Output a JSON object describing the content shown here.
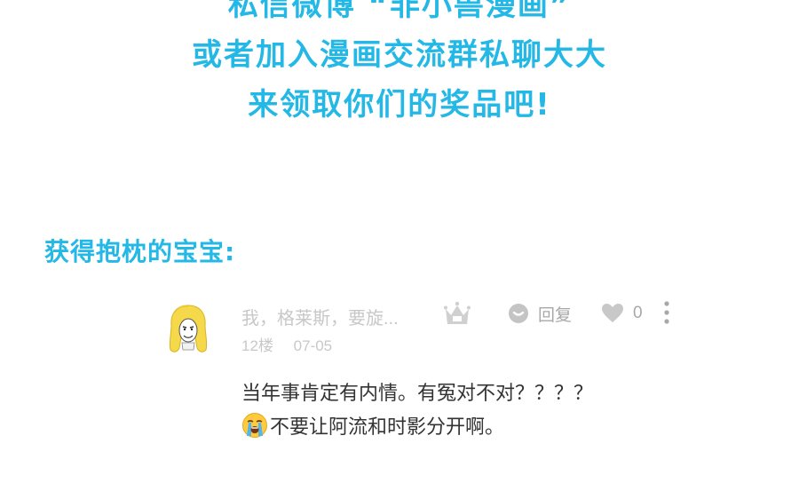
{
  "colors": {
    "accent": "#23b8e6",
    "muted": "#c8c8c8",
    "action": "#a8a8a8",
    "body_text": "#333333"
  },
  "announcement": {
    "line_1": "私信微博 “非小兽漫画”",
    "line_2": "或者加入漫画交流群私聊大大",
    "line_3": "来领取你们的奖品吧!"
  },
  "section_heading": "获得抱枕的宝宝:",
  "comment": {
    "username": "我，格莱斯，要旋...",
    "badge_icon": "crown-icon",
    "reply_label": "回复",
    "reply_icon": "speech-bubble-icon",
    "like_icon": "heart-icon",
    "like_count": "0",
    "more_icon": "more-vertical-icon",
    "floor": "12楼",
    "date": "07-05",
    "body_line_1": "当年事肯定有内情。有冤对不对？？？？",
    "body_line_2_emoji": "loudly-crying-face-icon",
    "body_line_2_text": "不要让阿流和时影分开啊。"
  }
}
